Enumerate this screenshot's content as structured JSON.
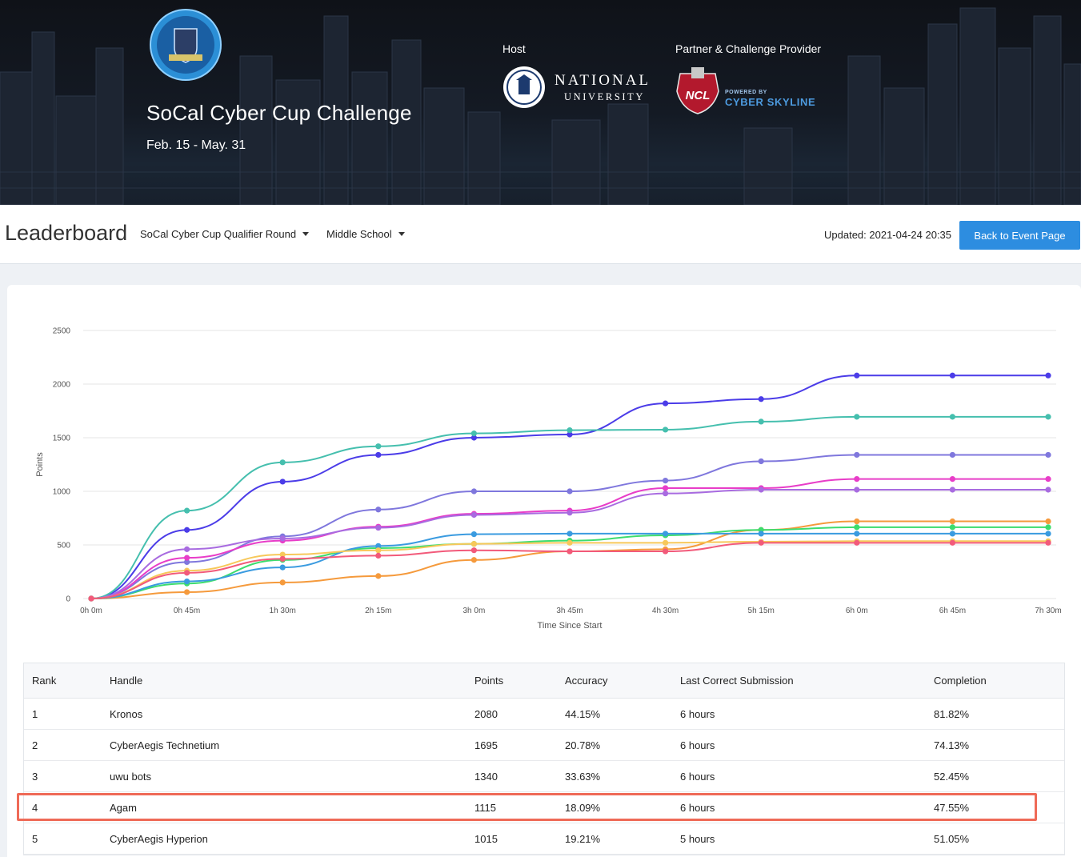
{
  "banner": {
    "title": "SoCal Cyber Cup Challenge",
    "dates": "Feb. 15 - May. 31",
    "host_label": "Host",
    "host_name_line1": "NATIONAL",
    "host_name_line2": "UNIVERSITY",
    "partner_label": "Partner & Challenge Provider",
    "partner_badge": "NCL",
    "partner_powered": "POWERED BY",
    "partner_name": "CYBER SKYLINE",
    "logo_year": "2020-2021",
    "colors": {
      "dark": "#141a24",
      "logo_blue": "#3a9be0"
    }
  },
  "toolbar": {
    "title": "Leaderboard",
    "round_select": "SoCal Cyber Cup Qualifier Round",
    "division_select": "Middle School",
    "updated": "Updated: 2021-04-24 20:35",
    "back_button": "Back to Event Page",
    "accent": "#2d8de0"
  },
  "chart_data": {
    "type": "line",
    "xlabel": "Time Since Start",
    "ylabel": "Points",
    "categories": [
      "0h 0m",
      "0h 45m",
      "1h 30m",
      "2h 15m",
      "3h 0m",
      "3h 45m",
      "4h 30m",
      "5h 15m",
      "6h 0m",
      "6h 45m",
      "7h 30m"
    ],
    "y_ticks": [
      "0",
      "500",
      "1000",
      "1500",
      "2000",
      "2500"
    ],
    "ylim": [
      0,
      2500
    ],
    "grid": true,
    "legend": "none",
    "series": [
      {
        "color": "#4b3ce8",
        "values": [
          0,
          640,
          1090,
          1340,
          1500,
          1530,
          1820,
          1860,
          2080,
          2080,
          2080
        ]
      },
      {
        "color": "#45bfae",
        "values": [
          0,
          820,
          1270,
          1420,
          1540,
          1570,
          1575,
          1650,
          1695,
          1695,
          1695
        ]
      },
      {
        "color": "#7f77dd",
        "values": [
          0,
          340,
          580,
          830,
          1000,
          1000,
          1100,
          1280,
          1340,
          1340,
          1340
        ]
      },
      {
        "color": "#e83dc8",
        "values": [
          0,
          380,
          540,
          670,
          790,
          820,
          1030,
          1030,
          1115,
          1115,
          1115
        ]
      },
      {
        "color": "#a86be0",
        "values": [
          0,
          460,
          560,
          660,
          780,
          800,
          980,
          1015,
          1015,
          1015,
          1015
        ]
      },
      {
        "color": "#f59a3c",
        "values": [
          0,
          60,
          150,
          210,
          360,
          440,
          460,
          640,
          720,
          720,
          720
        ]
      },
      {
        "color": "#3ddc6e",
        "values": [
          0,
          140,
          360,
          470,
          510,
          540,
          590,
          640,
          665,
          665,
          665
        ]
      },
      {
        "color": "#3a9be0",
        "values": [
          0,
          160,
          290,
          490,
          600,
          605,
          605,
          605,
          605,
          605,
          605
        ]
      },
      {
        "color": "#f7c85a",
        "values": [
          0,
          260,
          410,
          450,
          510,
          520,
          520,
          530,
          535,
          535,
          535
        ]
      },
      {
        "color": "#f25a7a",
        "values": [
          0,
          240,
          370,
          400,
          450,
          440,
          440,
          520,
          520,
          520,
          520
        ]
      }
    ]
  },
  "table": {
    "headers": {
      "rank": "Rank",
      "handle": "Handle",
      "points": "Points",
      "accuracy": "Accuracy",
      "last": "Last Correct Submission",
      "completion": "Completion"
    },
    "rows": [
      {
        "rank": "1",
        "handle": "Kronos",
        "points": "2080",
        "accuracy": "44.15%",
        "last": "6 hours",
        "completion": "81.82%"
      },
      {
        "rank": "2",
        "handle": "CyberAegis Technetium",
        "points": "1695",
        "accuracy": "20.78%",
        "last": "6 hours",
        "completion": "74.13%"
      },
      {
        "rank": "3",
        "handle": "uwu bots",
        "points": "1340",
        "accuracy": "33.63%",
        "last": "6 hours",
        "completion": "52.45%"
      },
      {
        "rank": "4",
        "handle": "Agam",
        "points": "1115",
        "accuracy": "18.09%",
        "last": "6 hours",
        "completion": "47.55%"
      },
      {
        "rank": "5",
        "handle": "CyberAegis Hyperion",
        "points": "1015",
        "accuracy": "19.21%",
        "last": "5 hours",
        "completion": "51.05%"
      }
    ],
    "highlight_color": "#ef6a57"
  }
}
